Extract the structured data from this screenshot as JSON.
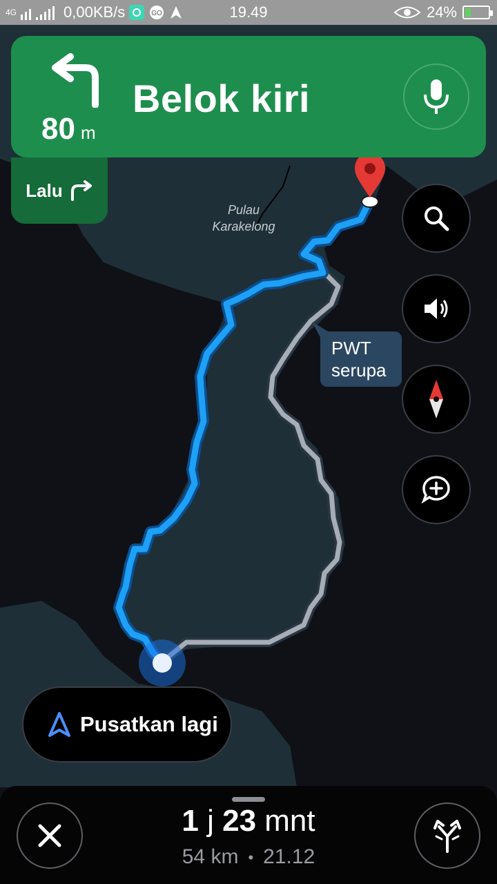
{
  "status_bar": {
    "network": "4G",
    "speed": "0,00KB/s",
    "time": "19.49",
    "battery": "24%",
    "battery_level": 0.24
  },
  "navigation": {
    "distance_value": "80",
    "distance_unit": "m",
    "instruction": "Belok kiri",
    "then_label": "Lalu",
    "turn_icon": "turn-left-icon",
    "then_icon": "turn-right-icon"
  },
  "map": {
    "island_label": "Pulau\nKarakelong",
    "callout": "PWT\nserupa",
    "route_color": "#1ea0f6",
    "alt_route_color": "#a6adb6",
    "land_color": "#1e2f38",
    "water_color": "#0f1116"
  },
  "controls": {
    "search_icon": "search-icon",
    "sound_icon": "speaker-icon",
    "compass_icon": "compass-icon",
    "report_icon": "add-report-icon"
  },
  "recenter": {
    "label": "Pusatkan lagi"
  },
  "trip": {
    "hours": "1",
    "hours_unit": "j",
    "minutes": "23",
    "minutes_unit": "mnt",
    "distance": "54 km",
    "arrival": "21.12",
    "separator": "•"
  },
  "colors": {
    "banner_green": "#1e8e4e",
    "then_green": "#156b39",
    "accent_blue": "#1a73e8",
    "pin_red": "#e53935"
  }
}
